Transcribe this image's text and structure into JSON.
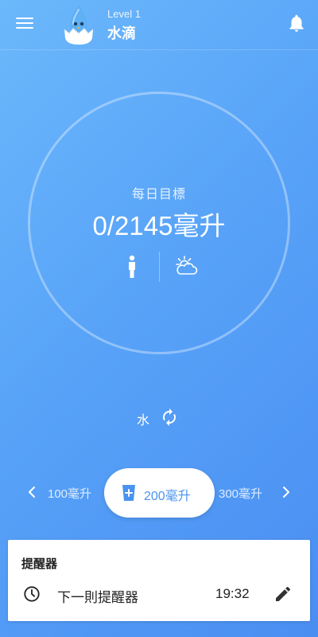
{
  "header": {
    "level": "Level 1",
    "app_title": "水滴",
    "icons": {
      "menu": "hamburger-menu-icon",
      "logo": "water-drop-mascot-logo",
      "notifications": "bell-icon"
    }
  },
  "goal": {
    "label": "每日目標",
    "value": "0/2145毫升",
    "icons": [
      "person-icon",
      "partly-cloudy-icon"
    ]
  },
  "drink_type": {
    "label": "水",
    "icon": "refresh-icon"
  },
  "volume_selector": {
    "previous": "100毫升",
    "selected": "200毫升",
    "next": "300毫升",
    "icons": {
      "left": "chevron-left-icon",
      "right": "chevron-right-icon",
      "cup": "water-cup-icon"
    }
  },
  "reminder_card": {
    "title": "提醒器",
    "next_label": "下一則提醒器",
    "time": "19:32",
    "icons": {
      "clock": "clock-icon",
      "edit": "pencil-icon"
    }
  },
  "colors": {
    "background_start": "#6cb8fb",
    "background_end": "#4a8ef2",
    "accent": "#4a93f0",
    "card": "#ffffff"
  }
}
